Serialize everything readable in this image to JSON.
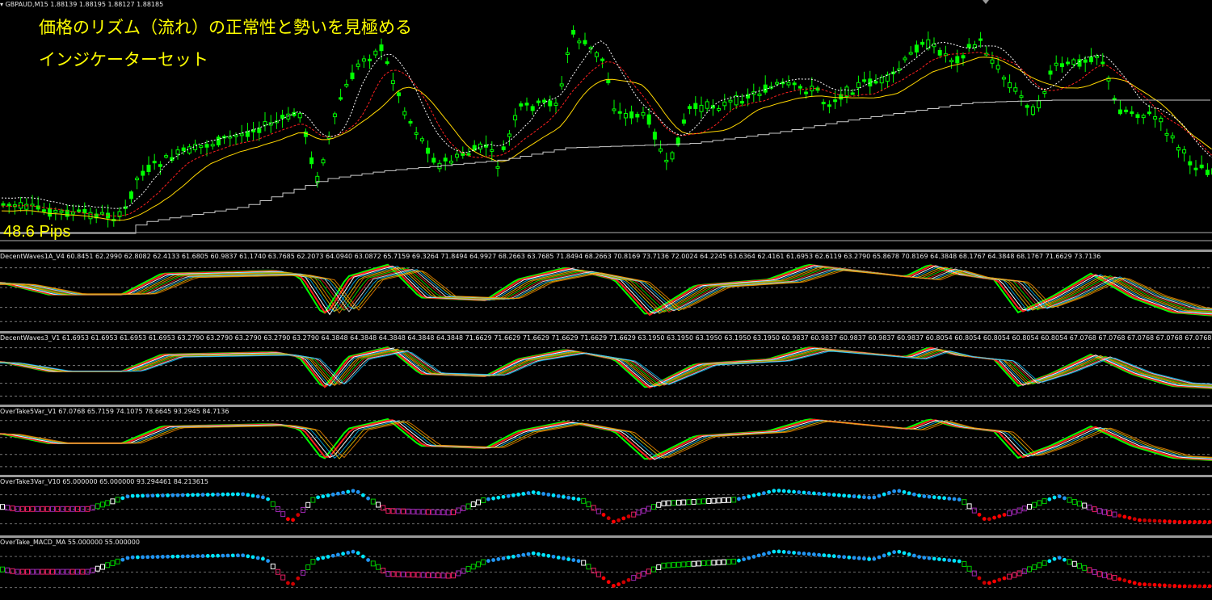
{
  "main": {
    "symbol_header": "GBPAUD,M15  1.88139 1.88195 1.88127 1.88185",
    "overlay_title": "価格のリズム（流れ）の正常性と勢いを見極める",
    "overlay_subtitle": "インジケーターセット",
    "pips_label": "48.6 Pips"
  },
  "panes": [
    {
      "id": "decent1",
      "label": "DecentWaves1A_V4 60.8451 62.2990 62.8082 62.4133 61.6805 60.9837 61.1740 63.7685 62.2073 64.0940 63.0872 65.7159 69.3264 71.8494 64.9927 68.2663 63.7685 71.8494 68.2663 70.8169 73.7136 72.0024 64.2245 63.6364 62.4161 61.6953 62.6119 63.2790 65.8678 70.8169 64.3848 68.1767 64.3848 68.1767 71.6629 73.7136"
    },
    {
      "id": "decent3",
      "label": "DecentWaves3_V1 61.6953 61.6953 61.6953 61.6953 63.2790 63.2790 63.2790 63.2790 63.2790 64.3848 64.3848 64.3848 64.3848 64.3848 71.6629 71.6629 71.6629 71.6629 71.6629 71.6629 63.1950 63.1950 63.1950 63.1950 63.1950 60.9837 60.9837 60.9837 60.9837 60.9837 60.8054 60.8054 60.8054 60.8054 60.8054 67.0768 67.0768 67.0768 67.0768 67.0768 67.0768 67.0768 67.0768 67.0768 67.0768 67.0"
    },
    {
      "id": "overtake5",
      "label": "OverTake5Var_V1 67.0768 65.7159 74.1075 78.6645 93.2945 84.7136"
    },
    {
      "id": "overtake3",
      "label": "OverTake3Var_V10 65.000000 65.000000 93.294461 84.213615"
    },
    {
      "id": "macd",
      "label": "OverTake_MACD_MA 55.000000 55.000000"
    }
  ],
  "colors": {
    "background": "#000000",
    "bull_candle": "#00ff00",
    "candle_body": "#000000",
    "ma_yellow": "#ffd700",
    "ma_red_dotted": "#ff2020",
    "ma_white_dotted": "#ffffff",
    "step_line": "#c8c8c8",
    "wave_colors": [
      "#00ff00",
      "#ff2020",
      "#ffffff",
      "#00bfff",
      "#ffd700",
      "#ff8c00"
    ],
    "dot_colors": [
      "#ff0000",
      "#00e5ff",
      "#2196f3",
      "#ffffff",
      "#00c800",
      "#9c27b0",
      "#e91e63",
      "#cc0000"
    ]
  },
  "icons": {
    "scroll_marker": "triangle-down-icon"
  }
}
